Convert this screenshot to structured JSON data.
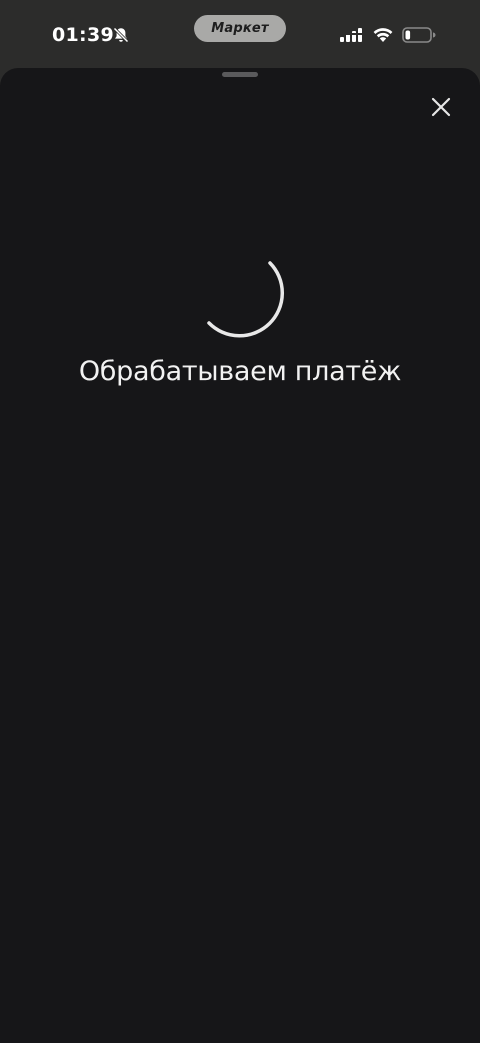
{
  "status_bar": {
    "time": "01:39",
    "app_pill_label": "Маркет",
    "icons": [
      "bell-slash-icon",
      "signal-icon",
      "wifi-icon",
      "battery-icon"
    ],
    "battery_level": 0.2
  },
  "sheet": {
    "close_icon": "close-icon",
    "loading_message": "Обрабатываем платёж"
  },
  "colors": {
    "status_bar_bg": "#2c2c2b",
    "sheet_bg": "#161618",
    "text": "#f2f2f2",
    "spinner": "#e8e8e8"
  }
}
